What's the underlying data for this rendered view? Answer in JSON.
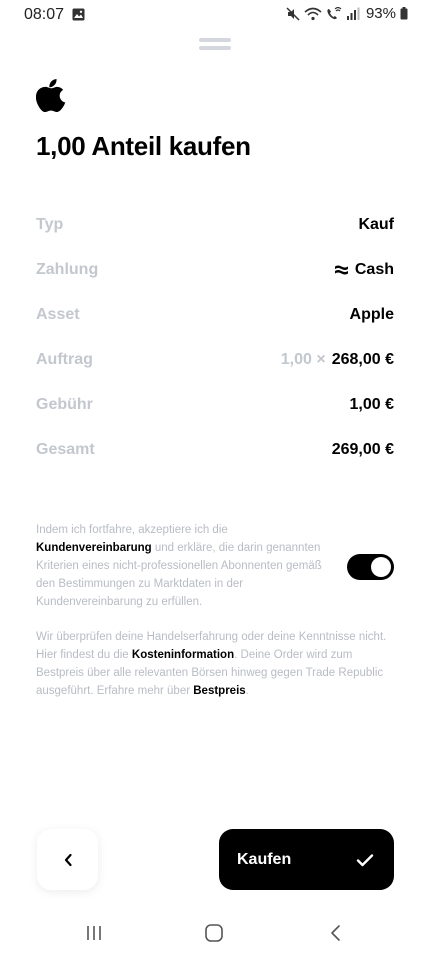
{
  "status_bar": {
    "time": "08:07",
    "battery": "93%",
    "icons": [
      "gallery-icon",
      "mute-icon",
      "wifi-icon",
      "wifi-call-icon",
      "signal-icon",
      "battery-icon"
    ]
  },
  "asset": {
    "logo_icon": "apple-logo-icon"
  },
  "title": "1,00 Anteil kaufen",
  "details": {
    "typ": {
      "label": "Typ",
      "value": "Kauf"
    },
    "zahlung": {
      "label": "Zahlung",
      "value": "Cash",
      "icon": "cash-icon"
    },
    "asset": {
      "label": "Asset",
      "value": "Apple"
    },
    "auftrag": {
      "label": "Auftrag",
      "quantity": "1,00 ×",
      "value": "268,00 €"
    },
    "gebuehr": {
      "label": "Gebühr",
      "value": "1,00 €"
    },
    "gesamt": {
      "label": "Gesamt",
      "value": "269,00 €"
    }
  },
  "consent": {
    "part1": "Indem ich fortfahre, akzeptiere ich die ",
    "link": "Kundenvereinbarung",
    "part2": " und erkläre, die darin genannten Kriterien eines nicht-professionellen Abonnenten gemäß den Bestimmungen zu Marktdaten in der Kundenvereinbarung zu erfüllen.",
    "toggle_on": true
  },
  "info": {
    "part1": "Wir überprüfen deine Handelserfahrung oder deine Kenntnisse nicht. Hier findest du die ",
    "link1": "Kosteninformation",
    "part2": ". Deine Order wird zum Bestpreis über alle relevanten Börsen hinweg gegen Trade Republic ausgeführt. Erfahre mehr über ",
    "link2": "Bestpreis",
    "part3": "."
  },
  "actions": {
    "back_icon": "chevron-left-icon",
    "buy_label": "Kaufen",
    "buy_icon": "checkmark-icon"
  },
  "colors": {
    "primary": "#000000",
    "muted": "#c3c7ce",
    "background": "#ffffff"
  }
}
